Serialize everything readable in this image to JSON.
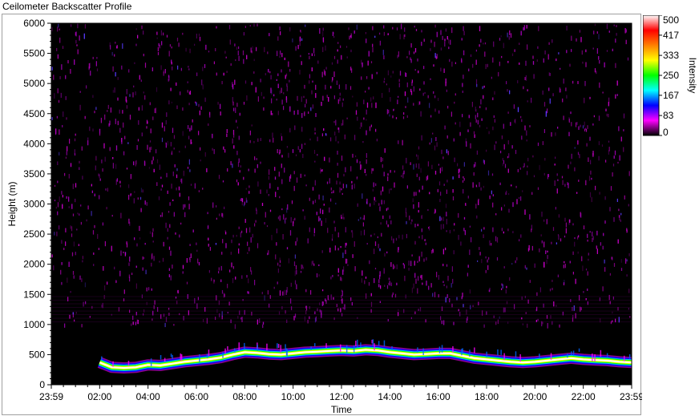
{
  "window": {
    "title": "Ceilometer Backscatter Profile"
  },
  "chart_data": {
    "type": "heatmap",
    "title": "Ceilometer Backscatter Profile",
    "xlabel": "Time",
    "ylabel": "Height (m)",
    "xticks": [
      "23:59",
      "02:00",
      "04:00",
      "06:00",
      "08:00",
      "10:00",
      "12:00",
      "14:00",
      "16:00",
      "18:00",
      "20:00",
      "22:00",
      "23:59"
    ],
    "yticks": [
      0,
      500,
      1000,
      1500,
      2000,
      2500,
      3000,
      3500,
      4000,
      4500,
      5000,
      5500,
      6000
    ],
    "ylim": [
      0,
      6000
    ],
    "xlim_hours": [
      0,
      24
    ],
    "colorbar": {
      "label": "Intensity",
      "ticks": [
        500,
        417,
        333,
        250,
        167,
        83,
        0
      ],
      "range": [
        0,
        500
      ],
      "colors": [
        "#000000",
        "#ff00ff",
        "#0000ff",
        "#00ffff",
        "#00ff00",
        "#ffff00",
        "#ff8000",
        "#ff0000",
        "#ffffff"
      ]
    },
    "background_noise_range_m": [
      1000,
      6000
    ],
    "aerosol_layer_height": {
      "hours": [
        2.0,
        2.5,
        3.0,
        3.5,
        4.0,
        4.5,
        5.0,
        5.5,
        6.0,
        6.5,
        7.0,
        7.5,
        8.0,
        8.5,
        9.0,
        9.5,
        10.0,
        10.5,
        11.0,
        11.5,
        12.0,
        12.5,
        13.0,
        13.5,
        14.0,
        14.5,
        15.0,
        15.5,
        16.0,
        16.5,
        17.0,
        17.5,
        18.0,
        18.5,
        19.0,
        19.5,
        20.0,
        20.5,
        21.0,
        21.5,
        22.0,
        22.5,
        23.0,
        23.5,
        24.0
      ],
      "height_m": [
        370,
        290,
        280,
        290,
        330,
        320,
        350,
        380,
        400,
        420,
        450,
        500,
        540,
        530,
        510,
        500,
        520,
        540,
        550,
        560,
        570,
        560,
        580,
        570,
        540,
        520,
        500,
        510,
        520,
        520,
        480,
        440,
        420,
        400,
        380,
        370,
        380,
        400,
        420,
        440,
        420,
        410,
        400,
        380,
        370
      ]
    }
  }
}
